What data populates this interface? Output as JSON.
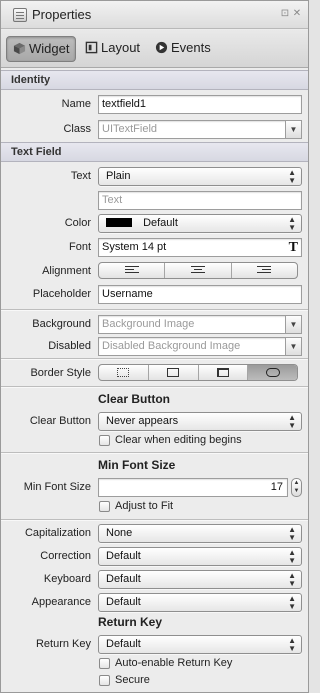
{
  "window": {
    "title": "Properties",
    "icons": {
      "title": "properties-icon",
      "detach": "detach-icon",
      "close": "close-icon"
    },
    "detach_glyph": "⊡",
    "close_glyph": "✕"
  },
  "tabs": [
    {
      "label": "Widget",
      "icon": "cube-icon",
      "active": true
    },
    {
      "label": "Layout",
      "icon": "layout-icon",
      "active": false
    },
    {
      "label": "Events",
      "icon": "arrow-circle-icon",
      "active": false
    }
  ],
  "identity": {
    "header": "Identity",
    "name_label": "Name",
    "name_value": "textfield1",
    "class_label": "Class",
    "class_placeholder": "UITextField"
  },
  "text_field": {
    "header": "Text Field",
    "text_label": "Text",
    "text_popup": "Plain",
    "text_placeholder": "Text",
    "color_label": "Color",
    "color_value": "Default",
    "color_swatch": "#000000",
    "font_label": "Font",
    "font_value": "System 14 pt",
    "font_icon_glyph": "T",
    "alignment_label": "Alignment",
    "alignment_options": [
      "left",
      "center",
      "right"
    ],
    "placeholder_label": "Placeholder",
    "placeholder_value": "Username"
  },
  "background": {
    "background_label": "Background",
    "background_placeholder": "Background Image",
    "disabled_label": "Disabled",
    "disabled_placeholder": "Disabled Background Image"
  },
  "border": {
    "label": "Border Style",
    "options": [
      "none",
      "line",
      "bezel",
      "rounded"
    ],
    "selected": 3
  },
  "clear_button": {
    "title": "Clear Button",
    "label": "Clear Button",
    "value": "Never appears",
    "checkbox_label": "Clear when editing begins",
    "checked": false
  },
  "min_font": {
    "title": "Min Font Size",
    "label": "Min Font Size",
    "value": "17",
    "checkbox_label": "Adjust to Fit",
    "checked": false
  },
  "text_input_traits": {
    "capitalization_label": "Capitalization",
    "capitalization_value": "None",
    "correction_label": "Correction",
    "correction_value": "Default",
    "keyboard_label": "Keyboard",
    "keyboard_value": "Default",
    "appearance_label": "Appearance",
    "appearance_value": "Default"
  },
  "return_key": {
    "title": "Return Key",
    "label": "Return Key",
    "value": "Default",
    "auto_enable_label": "Auto-enable Return Key",
    "auto_enable_checked": false,
    "secure_label": "Secure",
    "secure_checked": false
  },
  "glyphs": {
    "popup_up": "▲",
    "popup_down": "▼",
    "combo_down": "▼"
  }
}
